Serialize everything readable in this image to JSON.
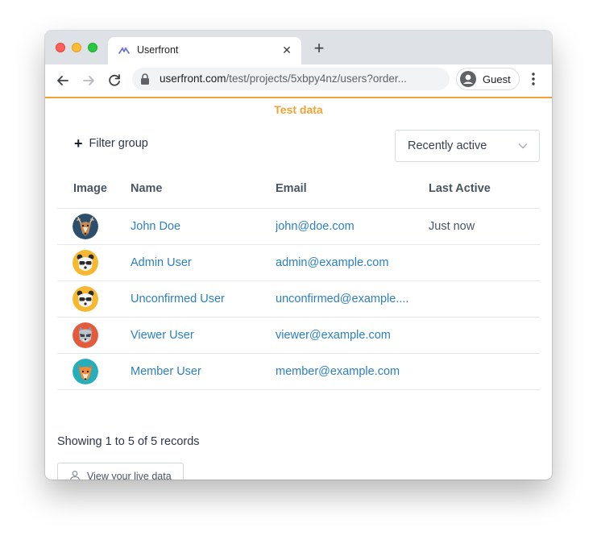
{
  "browser": {
    "tab_title": "Userfront",
    "tab_favicon": "userfront-logo-icon",
    "url_host": "userfront.com",
    "url_path": "/test/projects/5xbpy4nz/users?order...",
    "profile_label": "Guest"
  },
  "page": {
    "banner": "Test data",
    "filter_label": "Filter group",
    "sort_value": "Recently active",
    "columns": [
      "Image",
      "Name",
      "Email",
      "Last Active"
    ],
    "users": [
      {
        "name": "John Doe",
        "email": "john@doe.com",
        "last_active": "Just now",
        "avatar": "deer-avatar",
        "avatar_bg": "#2d4f6e"
      },
      {
        "name": "Admin User",
        "email": "admin@example.com",
        "last_active": "",
        "avatar": "panda-avatar",
        "avatar_bg": "#f5b82e"
      },
      {
        "name": "Unconfirmed User",
        "email": "unconfirmed@example....",
        "last_active": "",
        "avatar": "panda-avatar",
        "avatar_bg": "#f5b82e"
      },
      {
        "name": "Viewer User",
        "email": "viewer@example.com",
        "last_active": "",
        "avatar": "raccoon-avatar",
        "avatar_bg": "#e55a3b"
      },
      {
        "name": "Member User",
        "email": "member@example.com",
        "last_active": "",
        "avatar": "fox-avatar",
        "avatar_bg": "#27aebc"
      }
    ],
    "records_text": "Showing 1 to 5 of 5 records",
    "live_button": "View your live data"
  },
  "colors": {
    "accent": "#f0a330",
    "link": "#2b7fc4"
  }
}
